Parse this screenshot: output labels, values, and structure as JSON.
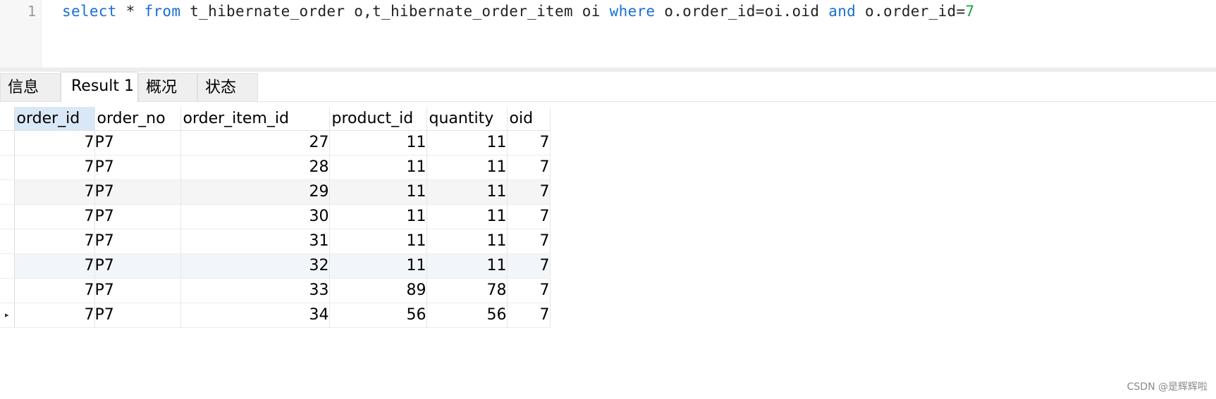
{
  "editor": {
    "line_number": "1",
    "tokens": [
      {
        "text": "select",
        "kind": "kw"
      },
      {
        "text": " * ",
        "kind": "plain"
      },
      {
        "text": "from",
        "kind": "kw"
      },
      {
        "text": " t_hibernate_order o,t_hibernate_order_item oi ",
        "kind": "plain"
      },
      {
        "text": "where",
        "kind": "kw"
      },
      {
        "text": " o.order_id=oi.oid ",
        "kind": "plain"
      },
      {
        "text": "and",
        "kind": "kw"
      },
      {
        "text": " o.order_id=",
        "kind": "plain"
      },
      {
        "text": "7",
        "kind": "num"
      }
    ]
  },
  "tabs": {
    "info": "信息",
    "result": "Result 1",
    "summary": "概况",
    "status": "状态",
    "active": "result"
  },
  "grid": {
    "columns": [
      {
        "key": "order_id",
        "label": "order_id",
        "align": "right"
      },
      {
        "key": "order_no",
        "label": "order_no",
        "align": "left"
      },
      {
        "key": "order_item_id",
        "label": "order_item_id",
        "align": "right"
      },
      {
        "key": "product_id",
        "label": "product_id",
        "align": "right"
      },
      {
        "key": "quantity",
        "label": "quantity",
        "align": "right"
      },
      {
        "key": "oid",
        "label": "oid",
        "align": "right"
      }
    ],
    "selected_column": "order_id",
    "current_row_index": 7,
    "rows": [
      [
        "7",
        "P7",
        "27",
        "11",
        "11",
        "7"
      ],
      [
        "7",
        "P7",
        "28",
        "11",
        "11",
        "7"
      ],
      [
        "7",
        "P7",
        "29",
        "11",
        "11",
        "7"
      ],
      [
        "7",
        "P7",
        "30",
        "11",
        "11",
        "7"
      ],
      [
        "7",
        "P7",
        "31",
        "11",
        "11",
        "7"
      ],
      [
        "7",
        "P7",
        "32",
        "11",
        "11",
        "7"
      ],
      [
        "7",
        "P7",
        "33",
        "89",
        "78",
        "7"
      ],
      [
        "7",
        "P7",
        "34",
        "56",
        "56",
        "7"
      ]
    ],
    "current_row_marker": "▸"
  },
  "watermark": "CSDN @是辉辉啦",
  "colors": {
    "keyword": "#1a6fd6",
    "number": "#1aa24a",
    "selected_header": "#d9e8f6"
  }
}
